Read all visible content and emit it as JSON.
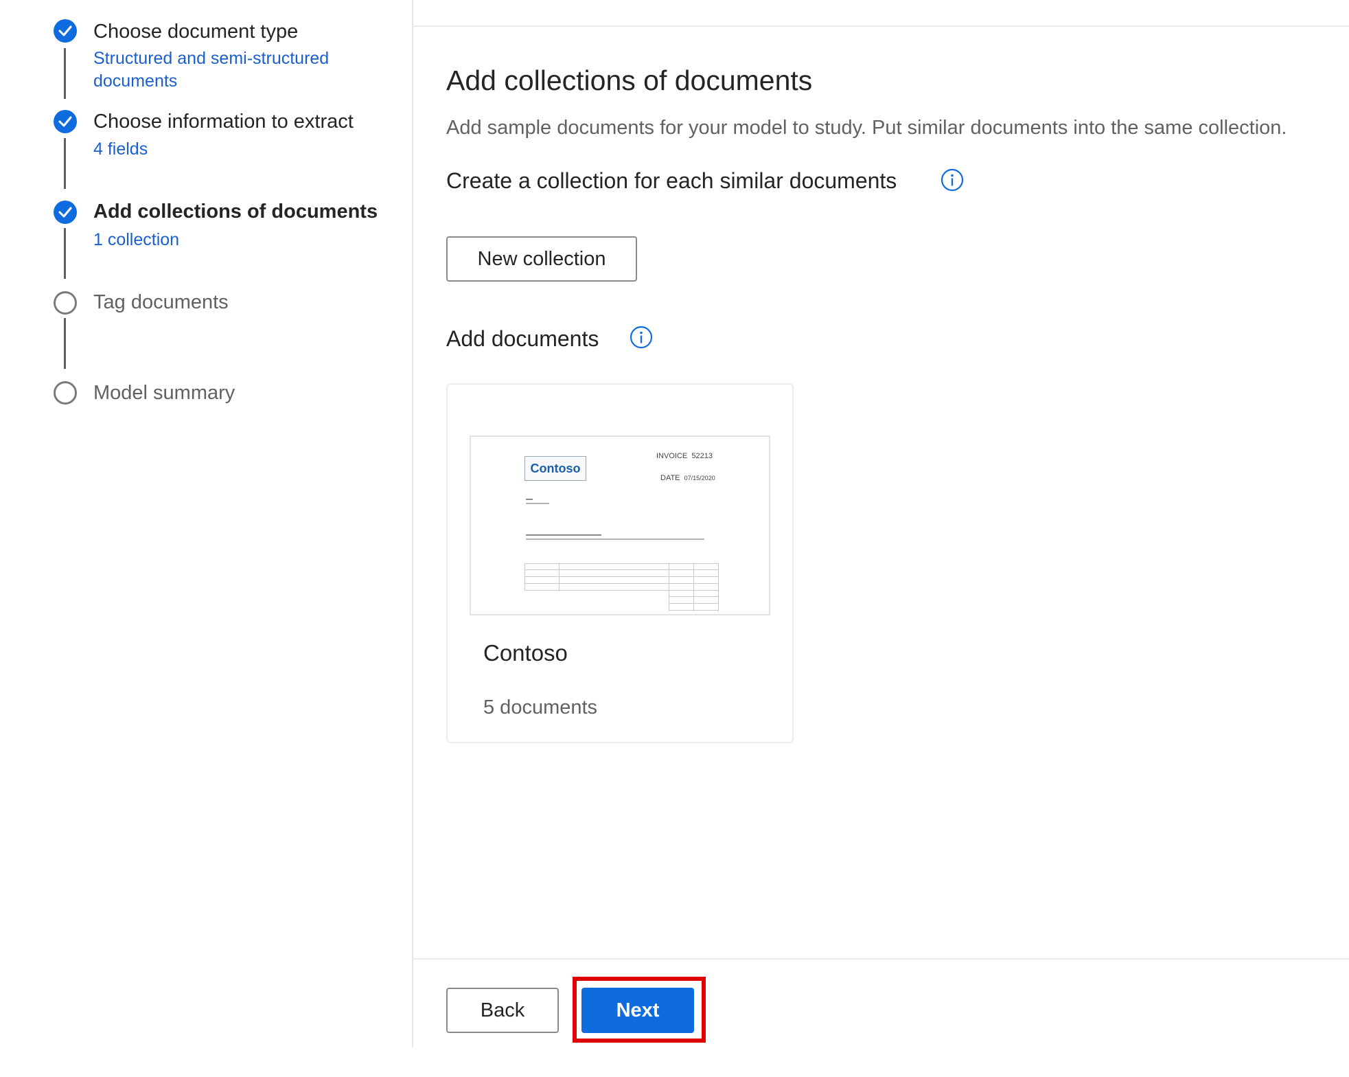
{
  "stepper": {
    "steps": [
      {
        "title": "Choose document type",
        "subtitle": "Structured and semi-structured documents",
        "status": "complete"
      },
      {
        "title": "Choose information to extract",
        "subtitle": "4 fields",
        "status": "complete"
      },
      {
        "title": "Add collections of documents",
        "subtitle": "1 collection",
        "status": "current"
      },
      {
        "title": "Tag documents",
        "subtitle": "",
        "status": "pending"
      },
      {
        "title": "Model summary",
        "subtitle": "",
        "status": "pending"
      }
    ]
  },
  "main": {
    "title": "Add collections of documents",
    "description": "Add sample documents for your model to study. Put similar documents into the same collection.",
    "create_heading": "Create a collection for each similar documents",
    "new_collection_label": "New collection",
    "add_documents_heading": "Add documents"
  },
  "collection_card": {
    "name": "Contoso",
    "count": "5 documents",
    "thumbnail": {
      "logo_text": "Contoso",
      "invoice_label": "INVOICE",
      "invoice_number": "52213",
      "date_label": "DATE",
      "date_value": "07/15/2020"
    }
  },
  "footer": {
    "back_label": "Back",
    "next_label": "Next"
  },
  "colors": {
    "accent": "#0f6cde",
    "link": "#1a5fd0",
    "highlight": "#e00000"
  },
  "icons": {
    "complete": "checkmark-circle-icon",
    "pending": "empty-circle-icon",
    "info": "info-icon"
  }
}
